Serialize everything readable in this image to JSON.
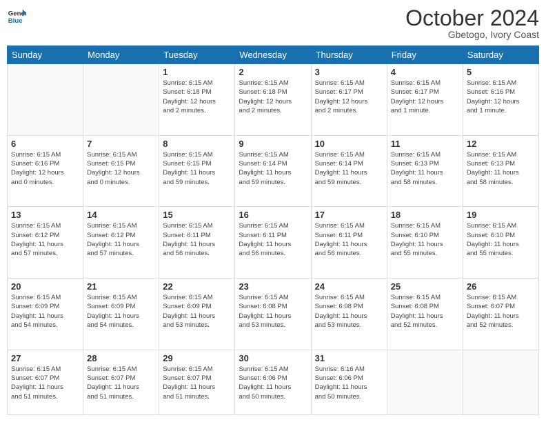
{
  "header": {
    "logo_line1": "General",
    "logo_line2": "Blue",
    "month": "October 2024",
    "location": "Gbetogo, Ivory Coast"
  },
  "weekdays": [
    "Sunday",
    "Monday",
    "Tuesday",
    "Wednesday",
    "Thursday",
    "Friday",
    "Saturday"
  ],
  "weeks": [
    [
      {
        "day": "",
        "info": ""
      },
      {
        "day": "",
        "info": ""
      },
      {
        "day": "1",
        "info": "Sunrise: 6:15 AM\nSunset: 6:18 PM\nDaylight: 12 hours\nand 2 minutes."
      },
      {
        "day": "2",
        "info": "Sunrise: 6:15 AM\nSunset: 6:18 PM\nDaylight: 12 hours\nand 2 minutes."
      },
      {
        "day": "3",
        "info": "Sunrise: 6:15 AM\nSunset: 6:17 PM\nDaylight: 12 hours\nand 2 minutes."
      },
      {
        "day": "4",
        "info": "Sunrise: 6:15 AM\nSunset: 6:17 PM\nDaylight: 12 hours\nand 1 minute."
      },
      {
        "day": "5",
        "info": "Sunrise: 6:15 AM\nSunset: 6:16 PM\nDaylight: 12 hours\nand 1 minute."
      }
    ],
    [
      {
        "day": "6",
        "info": "Sunrise: 6:15 AM\nSunset: 6:16 PM\nDaylight: 12 hours\nand 0 minutes."
      },
      {
        "day": "7",
        "info": "Sunrise: 6:15 AM\nSunset: 6:15 PM\nDaylight: 12 hours\nand 0 minutes."
      },
      {
        "day": "8",
        "info": "Sunrise: 6:15 AM\nSunset: 6:15 PM\nDaylight: 11 hours\nand 59 minutes."
      },
      {
        "day": "9",
        "info": "Sunrise: 6:15 AM\nSunset: 6:14 PM\nDaylight: 11 hours\nand 59 minutes."
      },
      {
        "day": "10",
        "info": "Sunrise: 6:15 AM\nSunset: 6:14 PM\nDaylight: 11 hours\nand 59 minutes."
      },
      {
        "day": "11",
        "info": "Sunrise: 6:15 AM\nSunset: 6:13 PM\nDaylight: 11 hours\nand 58 minutes."
      },
      {
        "day": "12",
        "info": "Sunrise: 6:15 AM\nSunset: 6:13 PM\nDaylight: 11 hours\nand 58 minutes."
      }
    ],
    [
      {
        "day": "13",
        "info": "Sunrise: 6:15 AM\nSunset: 6:12 PM\nDaylight: 11 hours\nand 57 minutes."
      },
      {
        "day": "14",
        "info": "Sunrise: 6:15 AM\nSunset: 6:12 PM\nDaylight: 11 hours\nand 57 minutes."
      },
      {
        "day": "15",
        "info": "Sunrise: 6:15 AM\nSunset: 6:11 PM\nDaylight: 11 hours\nand 56 minutes."
      },
      {
        "day": "16",
        "info": "Sunrise: 6:15 AM\nSunset: 6:11 PM\nDaylight: 11 hours\nand 56 minutes."
      },
      {
        "day": "17",
        "info": "Sunrise: 6:15 AM\nSunset: 6:11 PM\nDaylight: 11 hours\nand 56 minutes."
      },
      {
        "day": "18",
        "info": "Sunrise: 6:15 AM\nSunset: 6:10 PM\nDaylight: 11 hours\nand 55 minutes."
      },
      {
        "day": "19",
        "info": "Sunrise: 6:15 AM\nSunset: 6:10 PM\nDaylight: 11 hours\nand 55 minutes."
      }
    ],
    [
      {
        "day": "20",
        "info": "Sunrise: 6:15 AM\nSunset: 6:09 PM\nDaylight: 11 hours\nand 54 minutes."
      },
      {
        "day": "21",
        "info": "Sunrise: 6:15 AM\nSunset: 6:09 PM\nDaylight: 11 hours\nand 54 minutes."
      },
      {
        "day": "22",
        "info": "Sunrise: 6:15 AM\nSunset: 6:09 PM\nDaylight: 11 hours\nand 53 minutes."
      },
      {
        "day": "23",
        "info": "Sunrise: 6:15 AM\nSunset: 6:08 PM\nDaylight: 11 hours\nand 53 minutes."
      },
      {
        "day": "24",
        "info": "Sunrise: 6:15 AM\nSunset: 6:08 PM\nDaylight: 11 hours\nand 53 minutes."
      },
      {
        "day": "25",
        "info": "Sunrise: 6:15 AM\nSunset: 6:08 PM\nDaylight: 11 hours\nand 52 minutes."
      },
      {
        "day": "26",
        "info": "Sunrise: 6:15 AM\nSunset: 6:07 PM\nDaylight: 11 hours\nand 52 minutes."
      }
    ],
    [
      {
        "day": "27",
        "info": "Sunrise: 6:15 AM\nSunset: 6:07 PM\nDaylight: 11 hours\nand 51 minutes."
      },
      {
        "day": "28",
        "info": "Sunrise: 6:15 AM\nSunset: 6:07 PM\nDaylight: 11 hours\nand 51 minutes."
      },
      {
        "day": "29",
        "info": "Sunrise: 6:15 AM\nSunset: 6:07 PM\nDaylight: 11 hours\nand 51 minutes."
      },
      {
        "day": "30",
        "info": "Sunrise: 6:15 AM\nSunset: 6:06 PM\nDaylight: 11 hours\nand 50 minutes."
      },
      {
        "day": "31",
        "info": "Sunrise: 6:16 AM\nSunset: 6:06 PM\nDaylight: 11 hours\nand 50 minutes."
      },
      {
        "day": "",
        "info": ""
      },
      {
        "day": "",
        "info": ""
      }
    ]
  ]
}
